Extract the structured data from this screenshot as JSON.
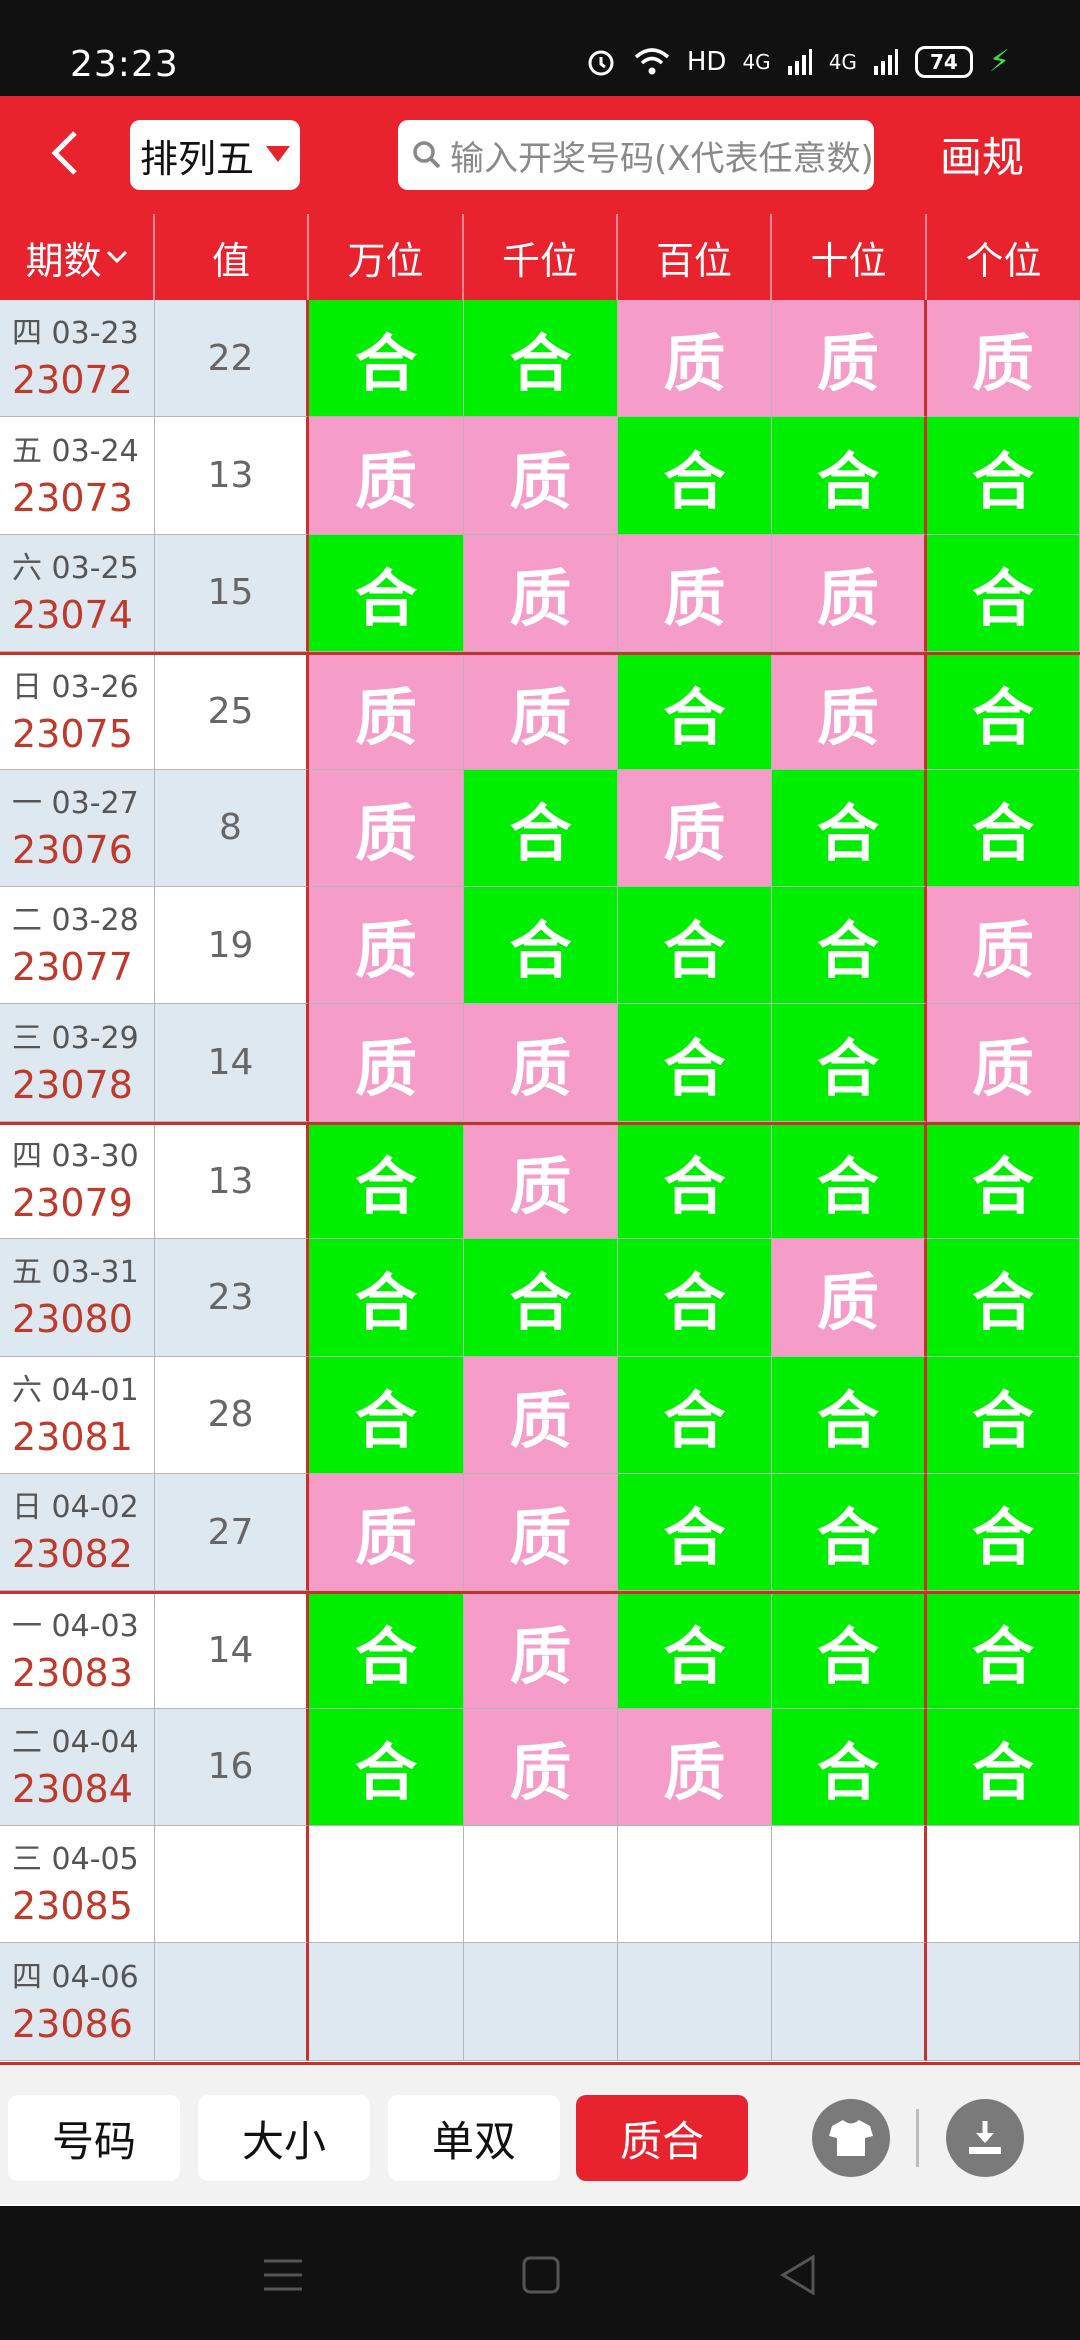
{
  "status_bar": {
    "time": "23:23",
    "network_label": "HD",
    "signal1": "4G",
    "signal2": "4G",
    "battery": "74"
  },
  "header": {
    "lottery_name": "排列五",
    "search_placeholder": "输入开奖号码(X代表任意数)",
    "draw_rule_label": "画规"
  },
  "table": {
    "columns": [
      "期数",
      "值",
      "万位",
      "千位",
      "百位",
      "十位",
      "个位"
    ],
    "rows": [
      {
        "date": "四 03-23",
        "issue": "23072",
        "value": "22",
        "cells": [
          "合",
          "合",
          "质",
          "质",
          "质"
        ]
      },
      {
        "date": "五 03-24",
        "issue": "23073",
        "value": "13",
        "cells": [
          "质",
          "质",
          "合",
          "合",
          "合"
        ]
      },
      {
        "date": "六 03-25",
        "issue": "23074",
        "value": "15",
        "cells": [
          "合",
          "质",
          "质",
          "质",
          "合"
        ]
      },
      {
        "date": "日 03-26",
        "issue": "23075",
        "value": "25",
        "cells": [
          "质",
          "质",
          "合",
          "质",
          "合"
        ]
      },
      {
        "date": "一 03-27",
        "issue": "23076",
        "value": "8",
        "cells": [
          "质",
          "合",
          "质",
          "合",
          "合"
        ]
      },
      {
        "date": "二 03-28",
        "issue": "23077",
        "value": "19",
        "cells": [
          "质",
          "合",
          "合",
          "合",
          "质"
        ]
      },
      {
        "date": "三 03-29",
        "issue": "23078",
        "value": "14",
        "cells": [
          "质",
          "质",
          "合",
          "合",
          "质"
        ]
      },
      {
        "date": "四 03-30",
        "issue": "23079",
        "value": "13",
        "cells": [
          "合",
          "质",
          "合",
          "合",
          "合"
        ]
      },
      {
        "date": "五 03-31",
        "issue": "23080",
        "value": "23",
        "cells": [
          "合",
          "合",
          "合",
          "质",
          "合"
        ]
      },
      {
        "date": "六 04-01",
        "issue": "23081",
        "value": "28",
        "cells": [
          "合",
          "质",
          "合",
          "合",
          "合"
        ]
      },
      {
        "date": "日 04-02",
        "issue": "23082",
        "value": "27",
        "cells": [
          "质",
          "质",
          "合",
          "合",
          "合"
        ]
      },
      {
        "date": "一 04-03",
        "issue": "23083",
        "value": "14",
        "cells": [
          "合",
          "质",
          "合",
          "合",
          "合"
        ]
      },
      {
        "date": "二 04-04",
        "issue": "23084",
        "value": "16",
        "cells": [
          "合",
          "质",
          "质",
          "合",
          "合"
        ]
      },
      {
        "date": "三 04-05",
        "issue": "23085",
        "value": "",
        "cells": [
          "",
          "",
          "",
          "",
          ""
        ]
      },
      {
        "date": "四 04-06",
        "issue": "23086",
        "value": "",
        "cells": [
          "",
          "",
          "",
          "",
          ""
        ]
      }
    ],
    "colors": {
      "he": "#00ee00",
      "zhi": "#f59cc8",
      "accent": "#e8232e",
      "issue_text": "#c0392b"
    }
  },
  "bottom_tabs": [
    {
      "label": "号码"
    },
    {
      "label": "大小"
    },
    {
      "label": "单双"
    },
    {
      "label": "质合",
      "active": true
    }
  ],
  "bottom_icons": [
    "shirt-icon",
    "download-icon"
  ]
}
